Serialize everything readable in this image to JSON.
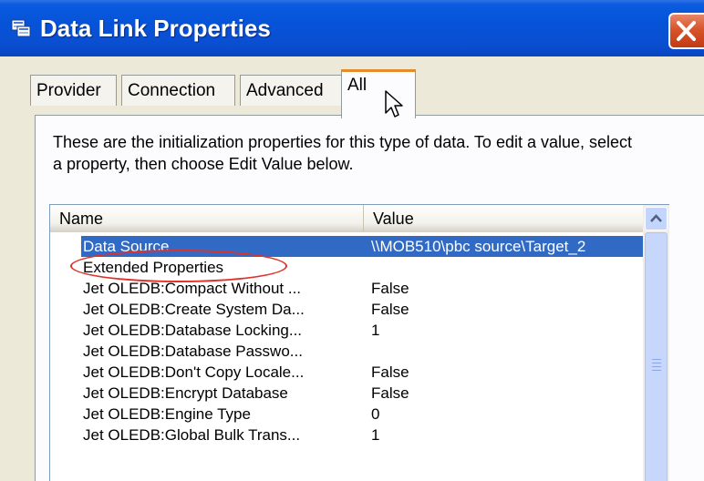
{
  "window": {
    "title": "Data Link Properties",
    "icon": "data-link-icon",
    "close_icon": "close-icon"
  },
  "tabs": [
    {
      "label": "Provider",
      "active": false
    },
    {
      "label": "Connection",
      "active": false
    },
    {
      "label": "Advanced",
      "active": false
    },
    {
      "label": "All",
      "active": true
    }
  ],
  "description": "These are the initialization properties for this type of data. To edit a value, select a property, then choose Edit Value below.",
  "list": {
    "columns": [
      "Name",
      "Value"
    ],
    "rows": [
      {
        "name": "Data Source",
        "value": "\\\\MOB510\\pbc source\\Target_2",
        "selected": true
      },
      {
        "name": "Extended Properties",
        "value": ""
      },
      {
        "name": "Jet OLEDB:Compact Without ...",
        "value": "False"
      },
      {
        "name": "Jet OLEDB:Create System Da...",
        "value": "False"
      },
      {
        "name": "Jet OLEDB:Database Locking...",
        "value": "1"
      },
      {
        "name": "Jet OLEDB:Database Passwo...",
        "value": ""
      },
      {
        "name": "Jet OLEDB:Don't Copy Locale...",
        "value": "False"
      },
      {
        "name": "Jet OLEDB:Encrypt Database",
        "value": "False"
      },
      {
        "name": "Jet OLEDB:Engine Type",
        "value": "0"
      },
      {
        "name": "Jet OLEDB:Global Bulk Trans...",
        "value": "1"
      }
    ]
  },
  "colors": {
    "titlebar": "#0653d8",
    "selection": "#316ac5",
    "active_tab_accent": "#e68b2c",
    "annotation_ring": "#e0302a"
  }
}
